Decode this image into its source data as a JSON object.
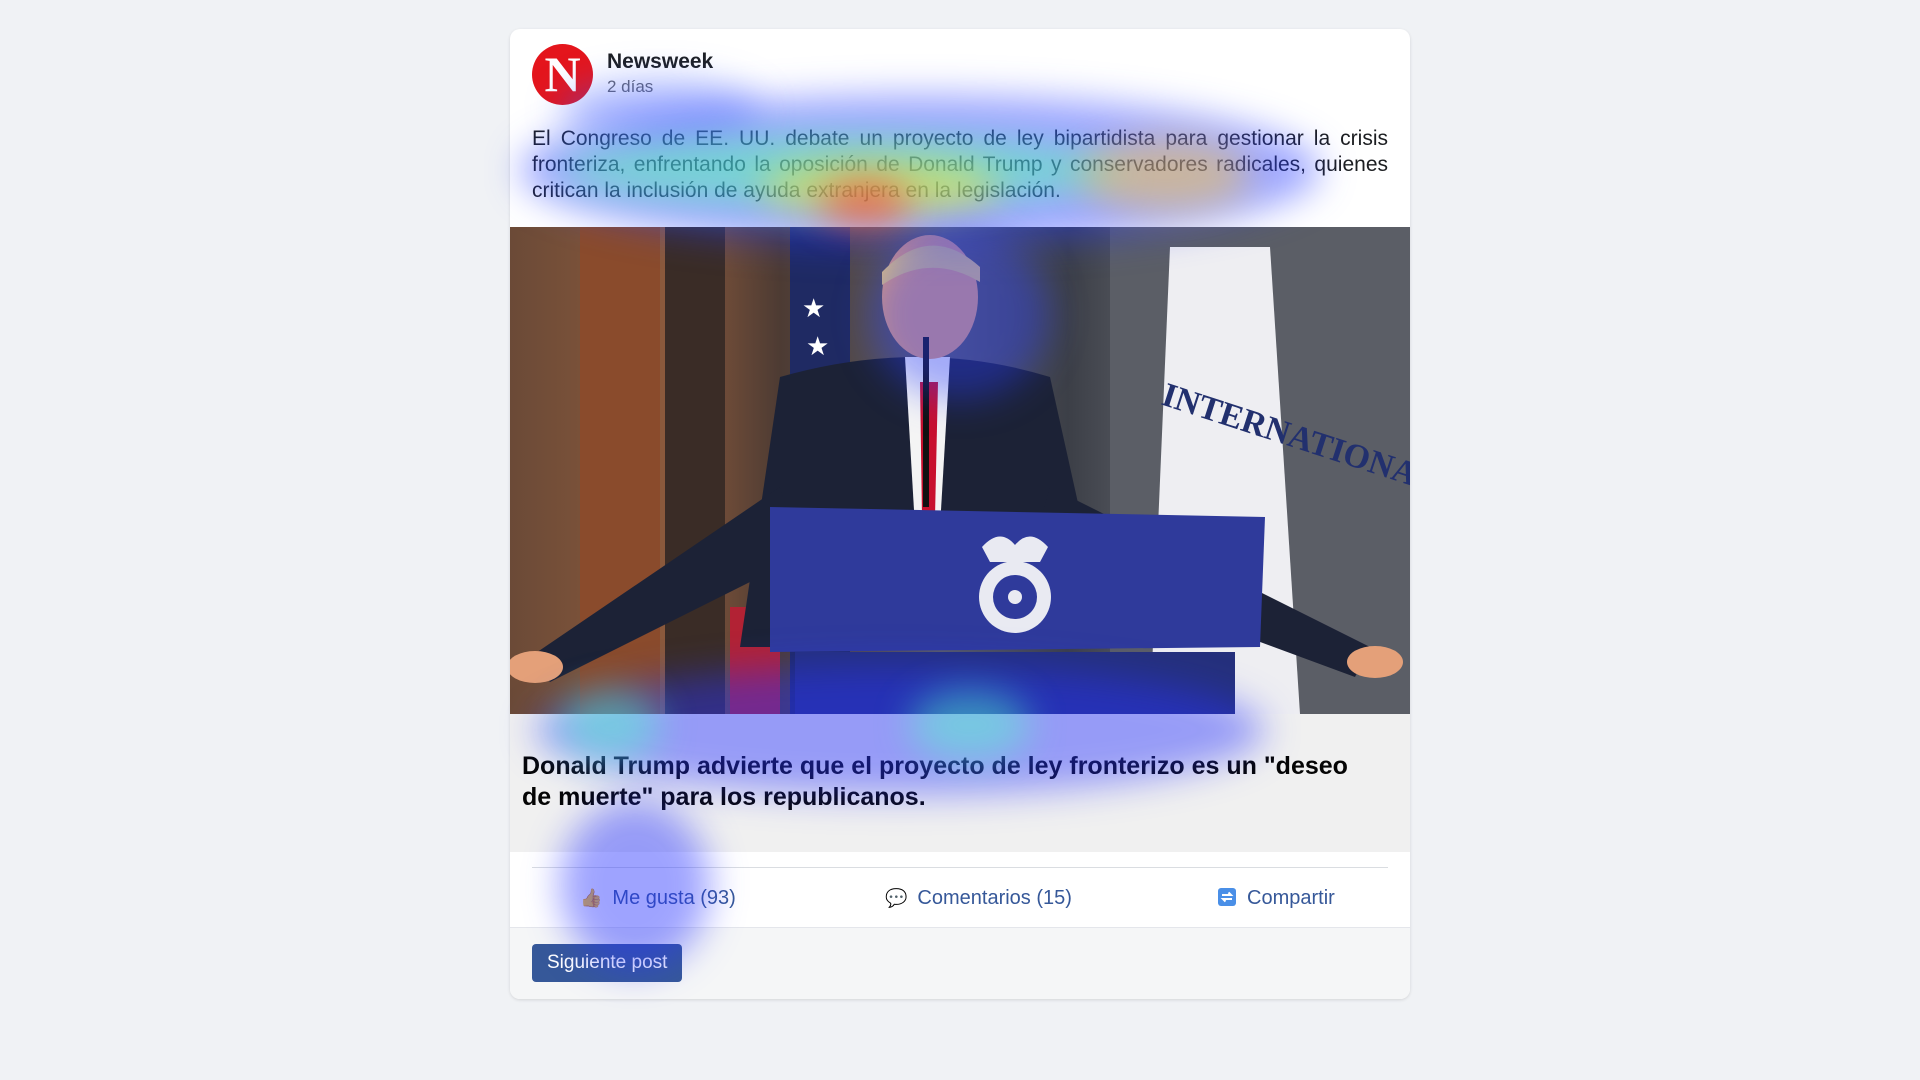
{
  "post": {
    "author": "Newsweek",
    "avatar_letter": "N",
    "time": "2 días",
    "text": "El Congreso de EE. UU. debate un proyecto de ley bipartidista para gestionar la crisis fronteriza, enfrentando la oposición de Donald Trump y conservadores radicales, quienes critican la inclusión de ayuda extranjera en la legislación.",
    "link_title": "Donald Trump advierte que el proyecto de ley fronterizo es un \"deseo de muerte\" para los republicanos."
  },
  "image": {
    "seal_text": "INTERNATIONAL"
  },
  "actions": {
    "like": "Me gusta (93)",
    "comments": "Comentarios (15)",
    "share": "Compartir"
  },
  "footer": {
    "next_label": "Siguiente post"
  },
  "colors": {
    "brand": "#e4151c",
    "link": "#365899",
    "background": "#f0f2f5"
  }
}
